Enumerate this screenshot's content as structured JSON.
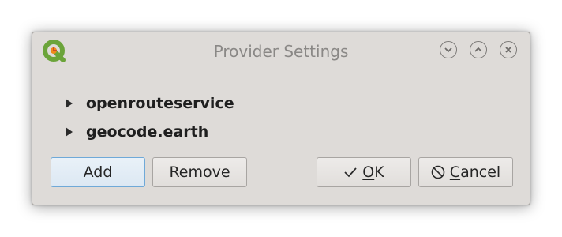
{
  "window": {
    "title": "Provider Settings",
    "app_icon": "qgis-logo-icon",
    "controls": {
      "minimize_icon": "chevron-down-icon",
      "maximize_icon": "chevron-up-icon",
      "close_icon": "close-icon"
    }
  },
  "tree": {
    "items": [
      {
        "label": "openrouteservice",
        "expander_icon": "triangle-right-icon"
      },
      {
        "label": "geocode.earth",
        "expander_icon": "triangle-right-icon"
      }
    ]
  },
  "buttons": {
    "add": "Add",
    "remove": "Remove",
    "ok_mnemonic": "O",
    "ok_rest": "K",
    "cancel_mnemonic": "C",
    "cancel_rest": "ancel",
    "ok_icon": "check-icon",
    "cancel_icon": "cancel-icon"
  },
  "colors": {
    "window_bg": "#dedbd8",
    "default_button_border": "#6fa9d8",
    "qgis_green": "#6ba43a",
    "qgis_orange": "#ef8a1b"
  }
}
